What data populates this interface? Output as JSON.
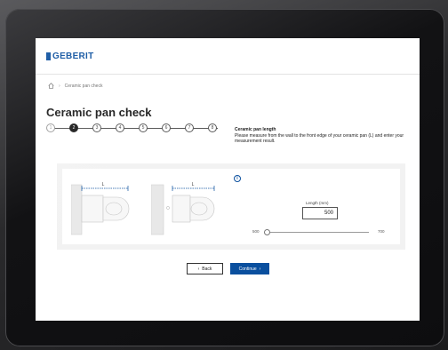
{
  "header": {
    "logo_text": "GEBERIT",
    "brand_color": "#0a4f9e"
  },
  "breadcrumb": {
    "home_icon": "home-icon",
    "current": "Ceramic pan check"
  },
  "page": {
    "title": "Ceramic pan check"
  },
  "stepper": {
    "steps": [
      "1",
      "2",
      "3",
      "4",
      "5",
      "6",
      "7",
      "8"
    ],
    "current_step": 2
  },
  "step_info": {
    "title": "Ceramic pan length",
    "text": "Please measure from the wall to the front edge of your ceramic pan (L) and enter your measurement result."
  },
  "measurement": {
    "diagram_label": "L",
    "info_icon": "i",
    "input_label": "Length (mm)",
    "input_value": "500",
    "slider_min": "500",
    "slider_max": "700",
    "slider_value": 500
  },
  "buttons": {
    "back_label": "Back",
    "continue_label": "Continue",
    "back_icon": "chevron-left-icon",
    "continue_icon": "chevron-right-icon"
  }
}
